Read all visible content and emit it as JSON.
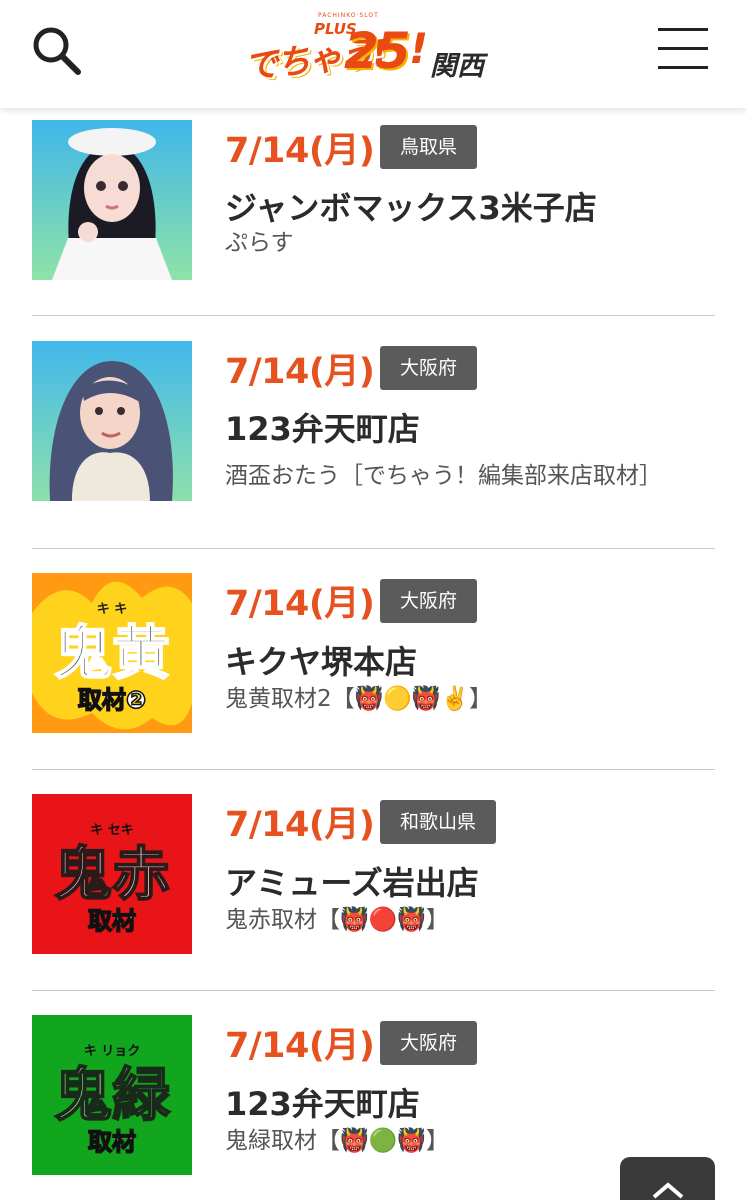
{
  "header": {
    "logo": {
      "brand_text": "でちゃう!",
      "plus_text": "PLUS",
      "sub_text": "PACHINKO·SLOT",
      "number": "25",
      "mark": "!",
      "region": "関西"
    },
    "icons": {
      "search": "search-icon",
      "menu": "hamburger-menu-icon"
    }
  },
  "items": [
    {
      "date": "7/14(月)",
      "pref": "鳥取県",
      "shop": "ジャンボマックス3米子店",
      "desc": "ぷらす",
      "thumb": "portrait-maid"
    },
    {
      "date": "7/14(月)",
      "pref": "大阪府",
      "shop": "123弁天町店",
      "desc": "酒盃おたう［でちゃう！編集部来店取材］",
      "thumb": "portrait-scarf"
    },
    {
      "date": "7/14(月)",
      "pref": "大阪府",
      "shop": "キクヤ堺本店",
      "desc": "鬼黄取材2【👹🟡👹✌️】",
      "thumb": "oni-yellow-badge",
      "thumb_text": {
        "main": "鬼黄",
        "ruby": "キ キ",
        "sub": "取材❷"
      }
    },
    {
      "date": "7/14(月)",
      "pref": "和歌山県",
      "shop": "アミューズ岩出店",
      "desc": "鬼赤取材【👹🔴👹】",
      "thumb": "oni-red-badge",
      "thumb_text": {
        "main": "鬼赤",
        "ruby": "キ セキ",
        "sub": "取材"
      }
    },
    {
      "date": "7/14(月)",
      "pref": "大阪府",
      "shop": "123弁天町店",
      "desc": "鬼緑取材【👹🟢👹】",
      "thumb": "oni-green-badge",
      "thumb_text": {
        "main": "鬼緑",
        "ruby": "キ リョク",
        "sub": "取材"
      }
    }
  ],
  "colors": {
    "accent": "#e5521f",
    "badge_bg": "#5b5b5b",
    "divider": "#c8c8c8"
  }
}
